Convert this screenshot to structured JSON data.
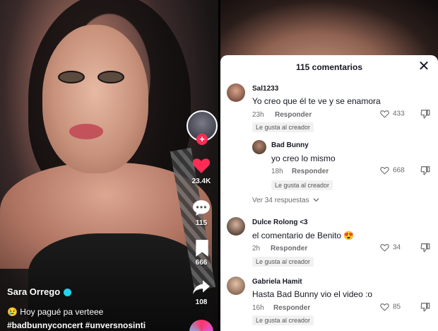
{
  "video": {
    "username": "Sara Orrego",
    "caption": "😢 Hoy pagué pa verteee",
    "hashtags": "#badbunnyconcert #unversnosinti",
    "likes": "23.4K",
    "comments": "115",
    "saves": "666",
    "shares": "108",
    "follow_symbol": "+"
  },
  "sheet": {
    "title": "115 comentarios",
    "close_symbol": "✕"
  },
  "comments": [
    {
      "name": "Sal1233",
      "text": "Yo creo que él te ve y se enamora",
      "time": "23h",
      "reply": "Responder",
      "likes": "433",
      "tag": "Le gusta al creador"
    },
    {
      "name": "Bad Bunny",
      "text": "yo creo lo mismo",
      "time": "18h",
      "reply": "Responder",
      "likes": "668",
      "tag": "Le gusta al creador"
    },
    {
      "name": "Dulce Rolong <3",
      "text": "el comentario de Benito 😍",
      "time": "2h",
      "reply": "Responder",
      "likes": "34",
      "tag": "Le gusta al creador"
    },
    {
      "name": "Gabriela Hamit",
      "text": "Hasta Bad Bunny vio el video :o",
      "time": "16h",
      "reply": "Responder",
      "likes": "85",
      "tag": "Le gusta al creador"
    }
  ],
  "more_replies": "Ver 34 respuestas",
  "colors": {
    "like_red": "#fe2c55",
    "verified": "#20d5ec"
  }
}
